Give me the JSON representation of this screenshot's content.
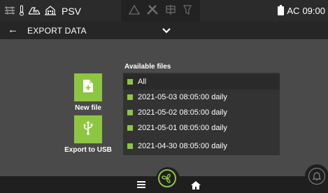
{
  "status_bar": {
    "unit_name": "PSV",
    "time": "09:00",
    "power_label": "AC",
    "left_icons": [
      "heat-exchanger-icon",
      "thermometer-icon",
      "airflow-icon",
      "building-icon"
    ],
    "center_icons": [
      "warning-triangle-icon",
      "tools-icon",
      "fan-service-icon",
      "filter-icon"
    ]
  },
  "header": {
    "title": "EXPORT DATA",
    "back_icon": "arrow-left-icon",
    "dropdown_icon": "chevron-down-icon"
  },
  "actions": {
    "new_file_label": "New file",
    "export_usb_label": "Export to USB"
  },
  "files": {
    "heading": "Available files",
    "items": [
      {
        "label": "All",
        "highlighted": true
      },
      {
        "label": "2021-05-03  08:05:00  daily"
      },
      {
        "label": "2021-05-02  08:05:00  daily"
      },
      {
        "label": "2021-05-01  08:05:00  daily"
      },
      {
        "label": "2021-04-30  08:05:00  daily"
      }
    ]
  },
  "bottom_nav": {
    "icons": [
      "menu-icon",
      "fan-icon",
      "home-icon",
      "alarm-bell-icon"
    ]
  },
  "colors": {
    "accent": "#8dc63f",
    "background": "#4a4a4a",
    "bar": "#262626"
  }
}
